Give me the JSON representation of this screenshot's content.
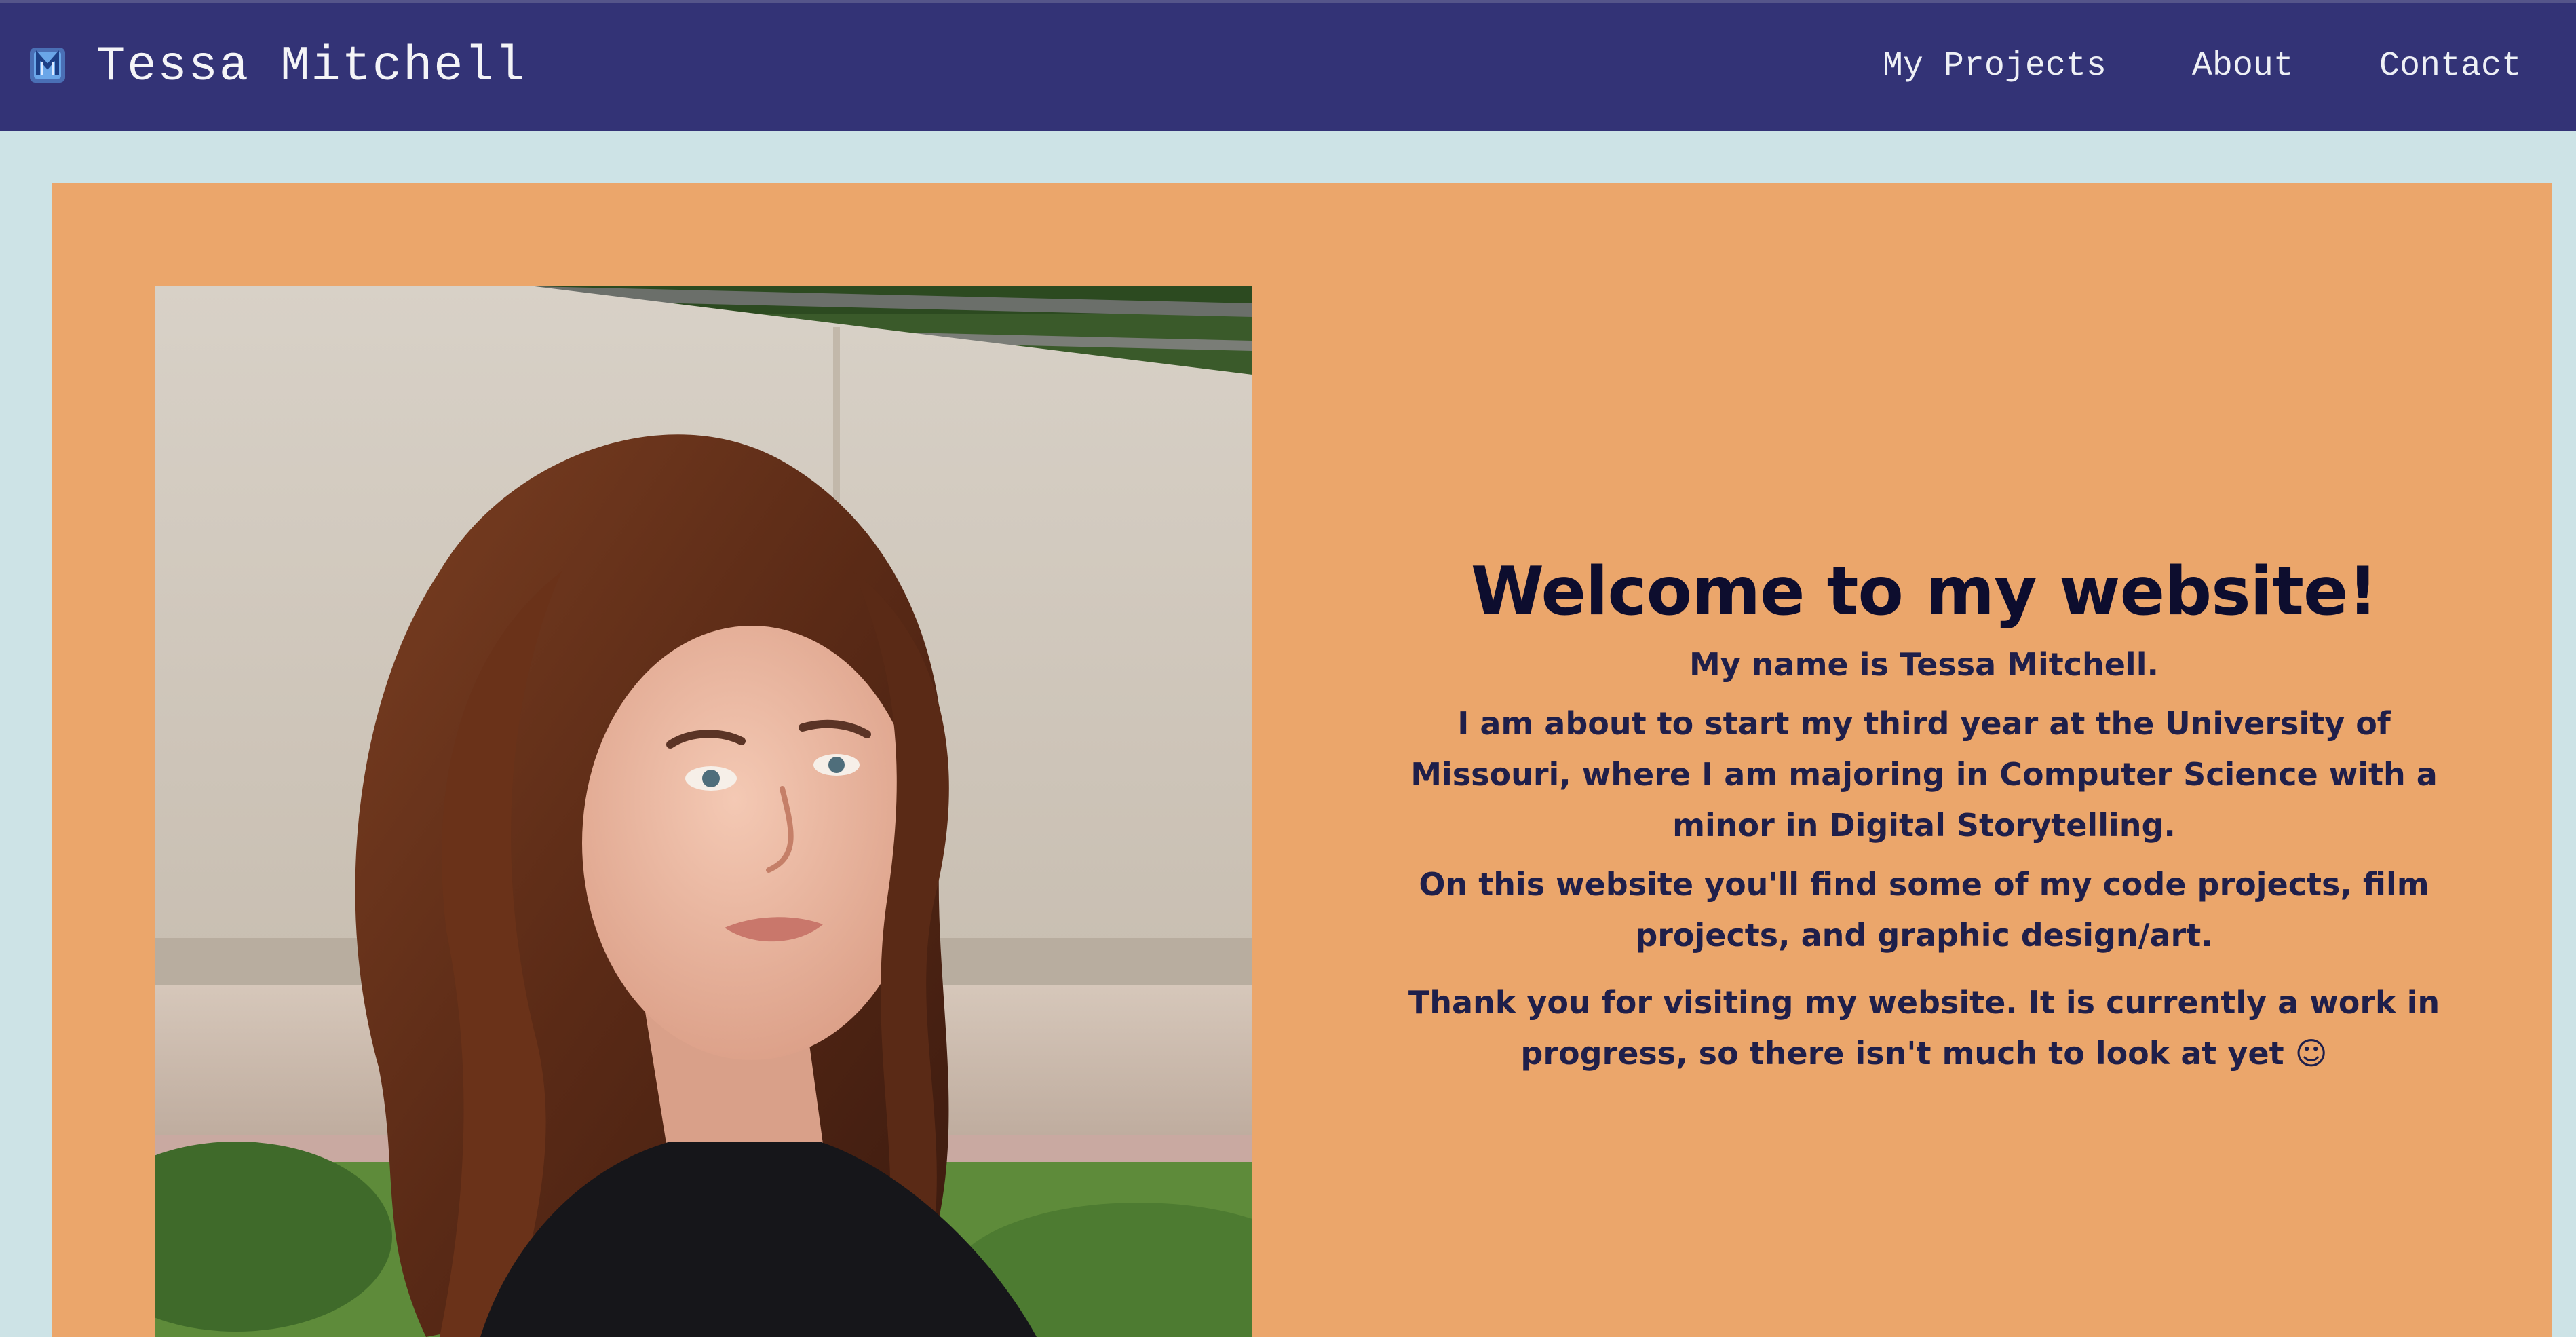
{
  "header": {
    "brand_name": "Tessa Mitchell",
    "logo_icon": "tm-monogram-icon",
    "nav": [
      {
        "label": "My Projects"
      },
      {
        "label": "About"
      },
      {
        "label": "Contact"
      }
    ]
  },
  "intro": {
    "title": "Welcome to my website!",
    "name_line": "My name is Tessa Mitchell.",
    "school_line": "I am about to start my third year at the University of Missouri, where I am majoring in Computer Science with a minor in Digital Storytelling.",
    "site_line": "On this website you'll find some of my code projects, film projects, and graphic design/art.",
    "thanks_line": "Thank you for visiting my website. It is currently a work in progress, so there isn't much to look at yet ☺"
  },
  "colors": {
    "navbar": "#333376",
    "page_background": "#cde3e6",
    "panel": "#eba66b",
    "heading_text": "#0d0d2e"
  }
}
